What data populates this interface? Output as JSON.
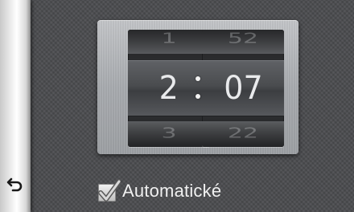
{
  "clock": {
    "hours": {
      "previous": "1",
      "current": "2",
      "next": "3"
    },
    "minutes": {
      "previous": "52",
      "current": "07",
      "next": "22"
    }
  },
  "automatic": {
    "label": "Automatické",
    "checked": true
  },
  "icons": {
    "back": "back-arrow-icon",
    "checkmark": "checkmark-icon"
  },
  "colors": {
    "background": "#4a4b4e",
    "plate": "#b3b5b8",
    "drum": "#4a4c4f",
    "digit": "#e9eaec"
  }
}
